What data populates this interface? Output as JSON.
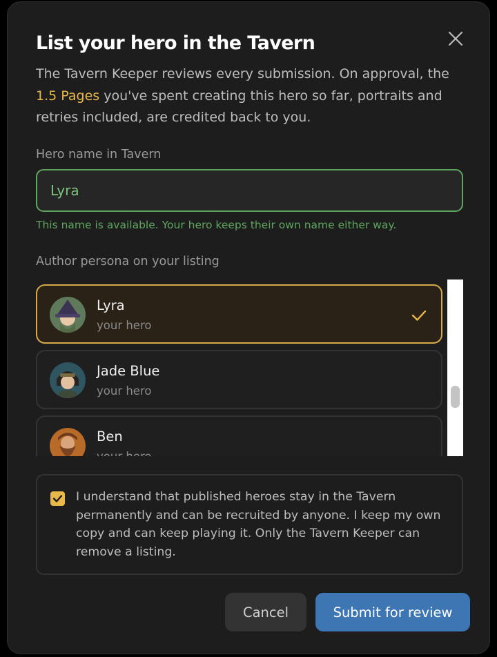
{
  "dialog": {
    "title": "List your hero in the Tavern",
    "intro_before": "The Tavern Keeper reviews every submission. On approval, the ",
    "intro_highlight": "1.5 Pages",
    "intro_after": " you've spent creating this hero so far, portraits and retries included, are credited back to you."
  },
  "hero_name": {
    "label": "Hero name in Tavern",
    "value": "Lyra",
    "hint": "This name is available. Your hero keeps their own name either way."
  },
  "persona": {
    "label": "Author persona on your listing",
    "items": [
      {
        "name": "Lyra",
        "sub": "your hero",
        "selected": true
      },
      {
        "name": "Jade Blue",
        "sub": "your hero",
        "selected": false
      },
      {
        "name": "Ben",
        "sub": "your hero",
        "selected": false
      }
    ]
  },
  "consent": {
    "checked": true,
    "text": "I understand that published heroes stay in the Tavern permanently and can be recruited by anyone. I keep my own copy and can keep playing it. Only the Tavern Keeper can remove a listing."
  },
  "actions": {
    "cancel": "Cancel",
    "submit": "Submit for review"
  },
  "colors": {
    "accent": "#e8b84a",
    "success": "#5fa65f",
    "primary": "#3e76b4"
  },
  "icons": {
    "close": "close-icon",
    "check": "checkmark-icon",
    "checkbox": "checkbox-checked-icon"
  }
}
